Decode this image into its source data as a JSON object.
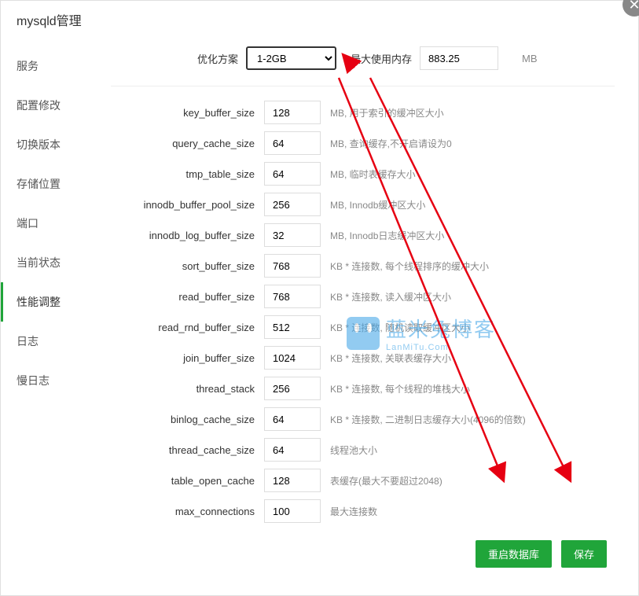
{
  "title": "mysqld管理",
  "sidebar": {
    "items": [
      {
        "label": "服务"
      },
      {
        "label": "配置修改"
      },
      {
        "label": "切换版本"
      },
      {
        "label": "存储位置"
      },
      {
        "label": "端口"
      },
      {
        "label": "当前状态"
      },
      {
        "label": "性能调整"
      },
      {
        "label": "日志"
      },
      {
        "label": "慢日志"
      }
    ],
    "active_index": 6
  },
  "top": {
    "scheme_label": "优化方案",
    "scheme_value": "1-2GB",
    "mem_label": "最大使用内存",
    "mem_value": "883.25",
    "mem_unit": "MB"
  },
  "fields": [
    {
      "label": "key_buffer_size",
      "value": "128",
      "desc": "MB, 用于索引的缓冲区大小"
    },
    {
      "label": "query_cache_size",
      "value": "64",
      "desc": "MB, 查询缓存,不开启请设为0"
    },
    {
      "label": "tmp_table_size",
      "value": "64",
      "desc": "MB, 临时表缓存大小"
    },
    {
      "label": "innodb_buffer_pool_size",
      "value": "256",
      "desc": "MB, Innodb缓冲区大小"
    },
    {
      "label": "innodb_log_buffer_size",
      "value": "32",
      "desc": "MB, Innodb日志缓冲区大小"
    },
    {
      "label": "sort_buffer_size",
      "value": "768",
      "desc": "KB * 连接数, 每个线程排序的缓冲大小"
    },
    {
      "label": "read_buffer_size",
      "value": "768",
      "desc": "KB * 连接数, 读入缓冲区大小"
    },
    {
      "label": "read_rnd_buffer_size",
      "value": "512",
      "desc": "KB * 连接数, 随机读取缓冲区大小"
    },
    {
      "label": "join_buffer_size",
      "value": "1024",
      "desc": "KB * 连接数, 关联表缓存大小"
    },
    {
      "label": "thread_stack",
      "value": "256",
      "desc": "KB * 连接数, 每个线程的堆栈大小"
    },
    {
      "label": "binlog_cache_size",
      "value": "64",
      "desc": "KB * 连接数, 二进制日志缓存大小(4096的倍数)"
    },
    {
      "label": "thread_cache_size",
      "value": "64",
      "desc": "线程池大小"
    },
    {
      "label": "table_open_cache",
      "value": "128",
      "desc": "表缓存(最大不要超过2048)"
    },
    {
      "label": "max_connections",
      "value": "100",
      "desc": "最大连接数"
    }
  ],
  "buttons": {
    "restart": "重启数据库",
    "save": "保存"
  },
  "watermark": {
    "main": "蓝米兔博客",
    "sub": "LanMiTu.Com"
  }
}
